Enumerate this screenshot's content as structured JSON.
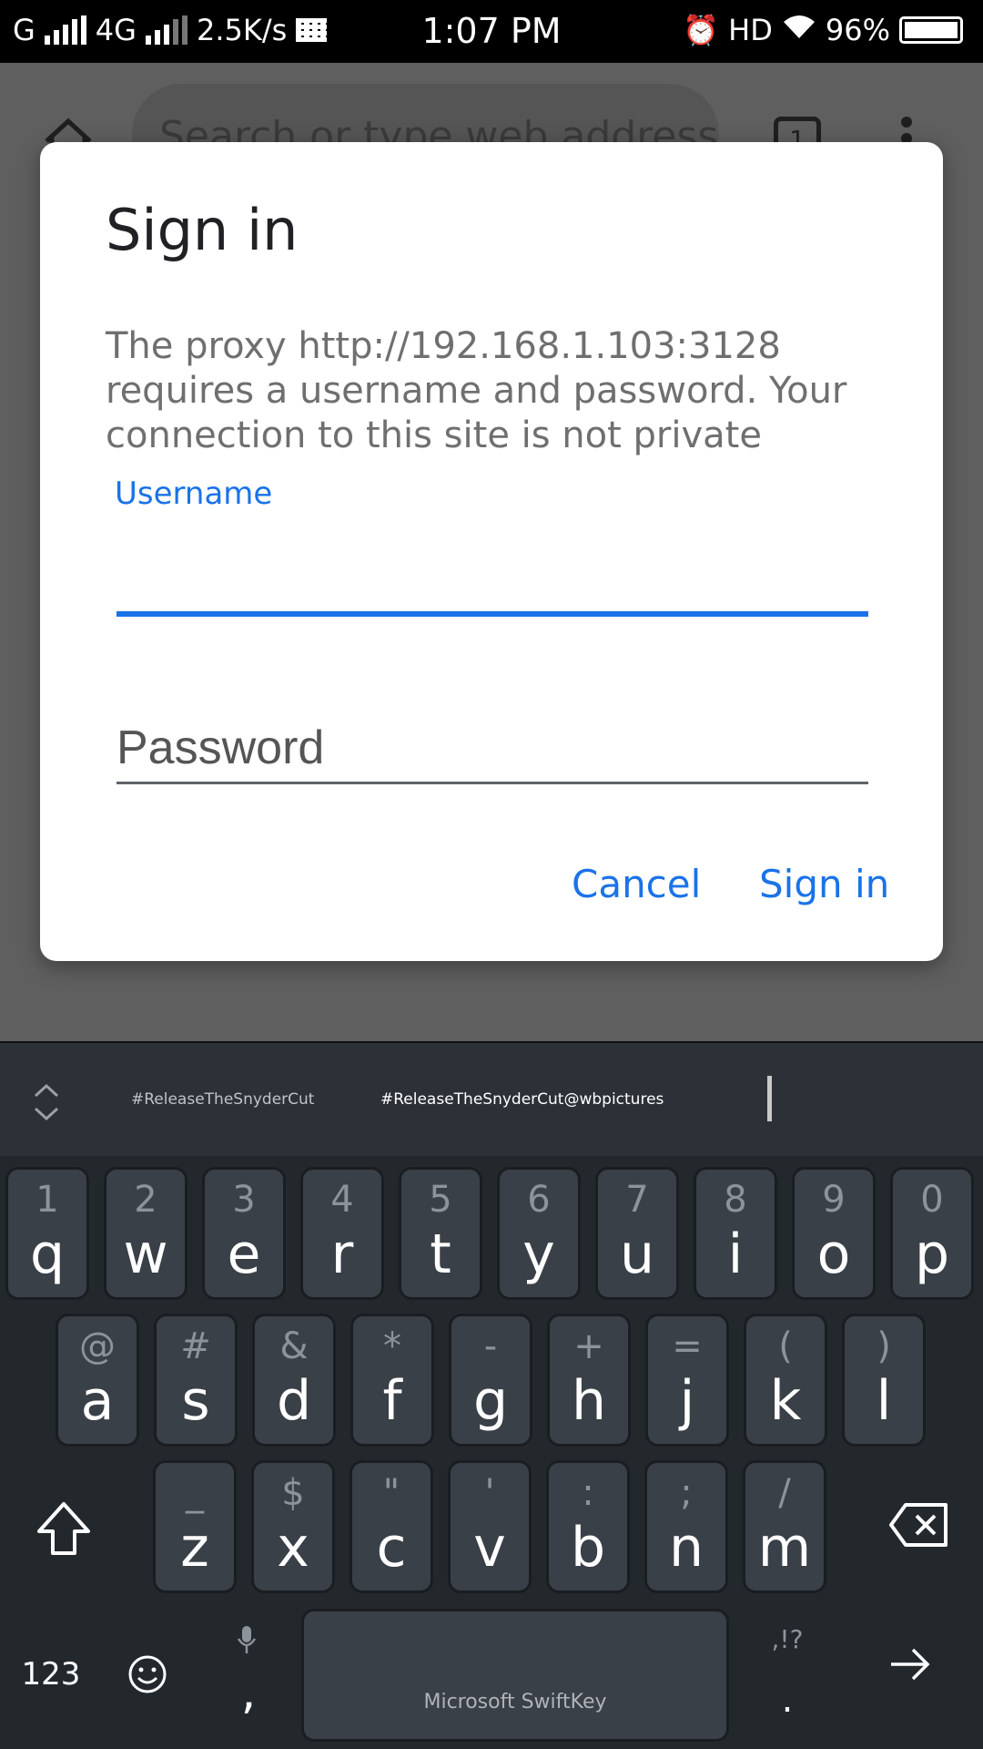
{
  "status_bar": {
    "network_1": "G",
    "network_2": "4G",
    "speed": "2.5K/s",
    "time": "1:07 PM",
    "hd": "HD",
    "battery": "96%"
  },
  "browser": {
    "address_placeholder": "Search or type web address",
    "tab_count": "1"
  },
  "dialog": {
    "title": "Sign in",
    "message": "The proxy http://192.168.1.103:3128 requires a username and password. Your connection to this site is not private",
    "username_label": "Username",
    "username_value": "",
    "password_placeholder": "Password",
    "cancel_label": "Cancel",
    "signin_label": "Sign in",
    "accent_color": "#1a73e8"
  },
  "keyboard": {
    "suggestions": [
      "#ReleaseTheSnyderCut",
      "#ReleaseTheSnyderCut@wbpictures"
    ],
    "row1": [
      {
        "hint": "1",
        "ch": "q"
      },
      {
        "hint": "2",
        "ch": "w"
      },
      {
        "hint": "3",
        "ch": "e"
      },
      {
        "hint": "4",
        "ch": "r"
      },
      {
        "hint": "5",
        "ch": "t"
      },
      {
        "hint": "6",
        "ch": "y"
      },
      {
        "hint": "7",
        "ch": "u"
      },
      {
        "hint": "8",
        "ch": "i"
      },
      {
        "hint": "9",
        "ch": "o"
      },
      {
        "hint": "0",
        "ch": "p"
      }
    ],
    "row2": [
      {
        "hint": "@",
        "ch": "a"
      },
      {
        "hint": "#",
        "ch": "s"
      },
      {
        "hint": "&",
        "ch": "d"
      },
      {
        "hint": "*",
        "ch": "f"
      },
      {
        "hint": "-",
        "ch": "g"
      },
      {
        "hint": "+",
        "ch": "h"
      },
      {
        "hint": "=",
        "ch": "j"
      },
      {
        "hint": "(",
        "ch": "k"
      },
      {
        "hint": ")",
        "ch": "l"
      }
    ],
    "row3": [
      {
        "hint": "_",
        "ch": "z"
      },
      {
        "hint": "$",
        "ch": "x"
      },
      {
        "hint": "\"",
        "ch": "c"
      },
      {
        "hint": "'",
        "ch": "v"
      },
      {
        "hint": ":",
        "ch": "b"
      },
      {
        "hint": ";",
        "ch": "n"
      },
      {
        "hint": "/",
        "ch": "m"
      }
    ],
    "numbers_label": "123",
    "comma": ",",
    "period": ".",
    "punct_hint": ",!?",
    "space_label": "Microsoft SwiftKey"
  }
}
